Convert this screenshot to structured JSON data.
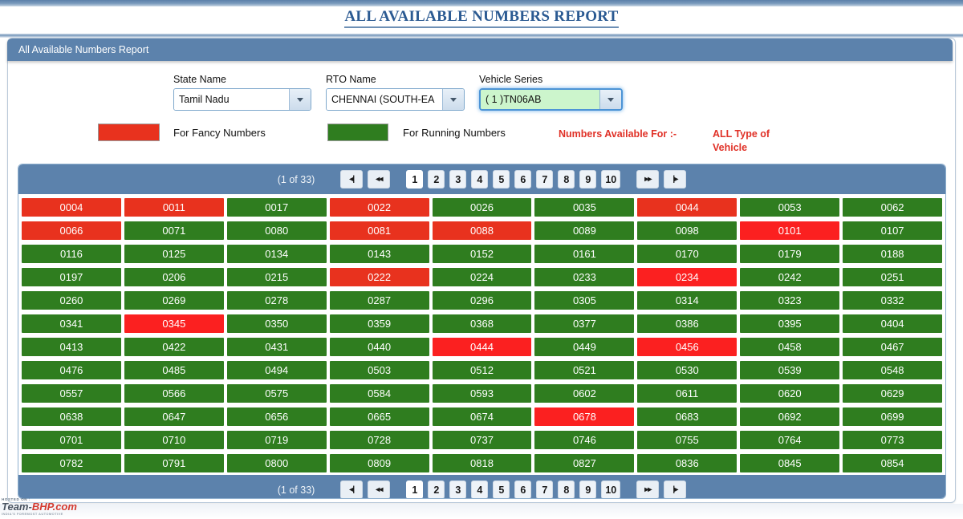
{
  "page": {
    "title": "ALL AVAILABLE NUMBERS REPORT",
    "panel_header": "All Available Numbers Report"
  },
  "filters": {
    "state": {
      "label": "State Name",
      "value": "Tamil Nadu"
    },
    "rto": {
      "label": "RTO Name",
      "value": "CHENNAI (SOUTH-EA"
    },
    "series": {
      "label": "Vehicle Series",
      "value": "( 1 )TN06AB"
    }
  },
  "legend": {
    "fancy_label": "For Fancy Numbers",
    "fancy_color": "#e8321e",
    "running_label": "For Running Numbers",
    "running_color": "#2f7d1f",
    "availability_label": "Numbers Available For :-",
    "availability_value": "ALL Type of Vehicle"
  },
  "pager": {
    "count_text": "(1 of 33)",
    "first_label": "◂|",
    "prev_label": "◂◂",
    "next_label": "▸▸",
    "last_label": "|▸",
    "pages": [
      "1",
      "2",
      "3",
      "4",
      "5",
      "6",
      "7",
      "8",
      "9",
      "10"
    ],
    "active_page": "1"
  },
  "grid": {
    "rows": [
      [
        {
          "v": "0004",
          "t": "red"
        },
        {
          "v": "0011",
          "t": "red"
        },
        {
          "v": "0017",
          "t": "green"
        },
        {
          "v": "0022",
          "t": "red"
        },
        {
          "v": "0026",
          "t": "green"
        },
        {
          "v": "0035",
          "t": "green"
        },
        {
          "v": "0044",
          "t": "red"
        },
        {
          "v": "0053",
          "t": "green"
        },
        {
          "v": "0062",
          "t": "green"
        }
      ],
      [
        {
          "v": "0066",
          "t": "red"
        },
        {
          "v": "0071",
          "t": "green"
        },
        {
          "v": "0080",
          "t": "green"
        },
        {
          "v": "0081",
          "t": "red"
        },
        {
          "v": "0088",
          "t": "red"
        },
        {
          "v": "0089",
          "t": "green"
        },
        {
          "v": "0098",
          "t": "green"
        },
        {
          "v": "0101",
          "t": "red2"
        },
        {
          "v": "0107",
          "t": "green"
        }
      ],
      [
        {
          "v": "0116",
          "t": "green"
        },
        {
          "v": "0125",
          "t": "green"
        },
        {
          "v": "0134",
          "t": "green"
        },
        {
          "v": "0143",
          "t": "green"
        },
        {
          "v": "0152",
          "t": "green"
        },
        {
          "v": "0161",
          "t": "green"
        },
        {
          "v": "0170",
          "t": "green"
        },
        {
          "v": "0179",
          "t": "green"
        },
        {
          "v": "0188",
          "t": "green"
        }
      ],
      [
        {
          "v": "0197",
          "t": "green"
        },
        {
          "v": "0206",
          "t": "green"
        },
        {
          "v": "0215",
          "t": "green"
        },
        {
          "v": "0222",
          "t": "red"
        },
        {
          "v": "0224",
          "t": "green"
        },
        {
          "v": "0233",
          "t": "green"
        },
        {
          "v": "0234",
          "t": "red2"
        },
        {
          "v": "0242",
          "t": "green"
        },
        {
          "v": "0251",
          "t": "green"
        }
      ],
      [
        {
          "v": "0260",
          "t": "green"
        },
        {
          "v": "0269",
          "t": "green"
        },
        {
          "v": "0278",
          "t": "green"
        },
        {
          "v": "0287",
          "t": "green"
        },
        {
          "v": "0296",
          "t": "green"
        },
        {
          "v": "0305",
          "t": "green"
        },
        {
          "v": "0314",
          "t": "green"
        },
        {
          "v": "0323",
          "t": "green"
        },
        {
          "v": "0332",
          "t": "green"
        }
      ],
      [
        {
          "v": "0341",
          "t": "green"
        },
        {
          "v": "0345",
          "t": "red2"
        },
        {
          "v": "0350",
          "t": "green"
        },
        {
          "v": "0359",
          "t": "green"
        },
        {
          "v": "0368",
          "t": "green"
        },
        {
          "v": "0377",
          "t": "green"
        },
        {
          "v": "0386",
          "t": "green"
        },
        {
          "v": "0395",
          "t": "green"
        },
        {
          "v": "0404",
          "t": "green"
        }
      ],
      [
        {
          "v": "0413",
          "t": "green"
        },
        {
          "v": "0422",
          "t": "green"
        },
        {
          "v": "0431",
          "t": "green"
        },
        {
          "v": "0440",
          "t": "green"
        },
        {
          "v": "0444",
          "t": "red2"
        },
        {
          "v": "0449",
          "t": "green"
        },
        {
          "v": "0456",
          "t": "red2"
        },
        {
          "v": "0458",
          "t": "green"
        },
        {
          "v": "0467",
          "t": "green"
        }
      ],
      [
        {
          "v": "0476",
          "t": "green"
        },
        {
          "v": "0485",
          "t": "green"
        },
        {
          "v": "0494",
          "t": "green"
        },
        {
          "v": "0503",
          "t": "green"
        },
        {
          "v": "0512",
          "t": "green"
        },
        {
          "v": "0521",
          "t": "green"
        },
        {
          "v": "0530",
          "t": "green"
        },
        {
          "v": "0539",
          "t": "green"
        },
        {
          "v": "0548",
          "t": "green"
        }
      ],
      [
        {
          "v": "0557",
          "t": "green"
        },
        {
          "v": "0566",
          "t": "green"
        },
        {
          "v": "0575",
          "t": "green"
        },
        {
          "v": "0584",
          "t": "green"
        },
        {
          "v": "0593",
          "t": "green"
        },
        {
          "v": "0602",
          "t": "green"
        },
        {
          "v": "0611",
          "t": "green"
        },
        {
          "v": "0620",
          "t": "green"
        },
        {
          "v": "0629",
          "t": "green"
        }
      ],
      [
        {
          "v": "0638",
          "t": "green"
        },
        {
          "v": "0647",
          "t": "green"
        },
        {
          "v": "0656",
          "t": "green"
        },
        {
          "v": "0665",
          "t": "green"
        },
        {
          "v": "0674",
          "t": "green"
        },
        {
          "v": "0678",
          "t": "red2"
        },
        {
          "v": "0683",
          "t": "green"
        },
        {
          "v": "0692",
          "t": "green"
        },
        {
          "v": "0699",
          "t": "green"
        }
      ],
      [
        {
          "v": "0701",
          "t": "green"
        },
        {
          "v": "0710",
          "t": "green"
        },
        {
          "v": "0719",
          "t": "green"
        },
        {
          "v": "0728",
          "t": "green"
        },
        {
          "v": "0737",
          "t": "green"
        },
        {
          "v": "0746",
          "t": "green"
        },
        {
          "v": "0755",
          "t": "green"
        },
        {
          "v": "0764",
          "t": "green"
        },
        {
          "v": "0773",
          "t": "green"
        }
      ],
      [
        {
          "v": "0782",
          "t": "green"
        },
        {
          "v": "0791",
          "t": "green"
        },
        {
          "v": "0800",
          "t": "green"
        },
        {
          "v": "0809",
          "t": "green"
        },
        {
          "v": "0818",
          "t": "green"
        },
        {
          "v": "0827",
          "t": "green"
        },
        {
          "v": "0836",
          "t": "green"
        },
        {
          "v": "0845",
          "t": "green"
        },
        {
          "v": "0854",
          "t": "green"
        }
      ]
    ]
  },
  "watermark": {
    "top": "HOSTED ON :",
    "brand_a": "Team-",
    "brand_b": "BHP.com",
    "bottom": "INDIA'S FOREMOST AUTOMOTIVE"
  }
}
